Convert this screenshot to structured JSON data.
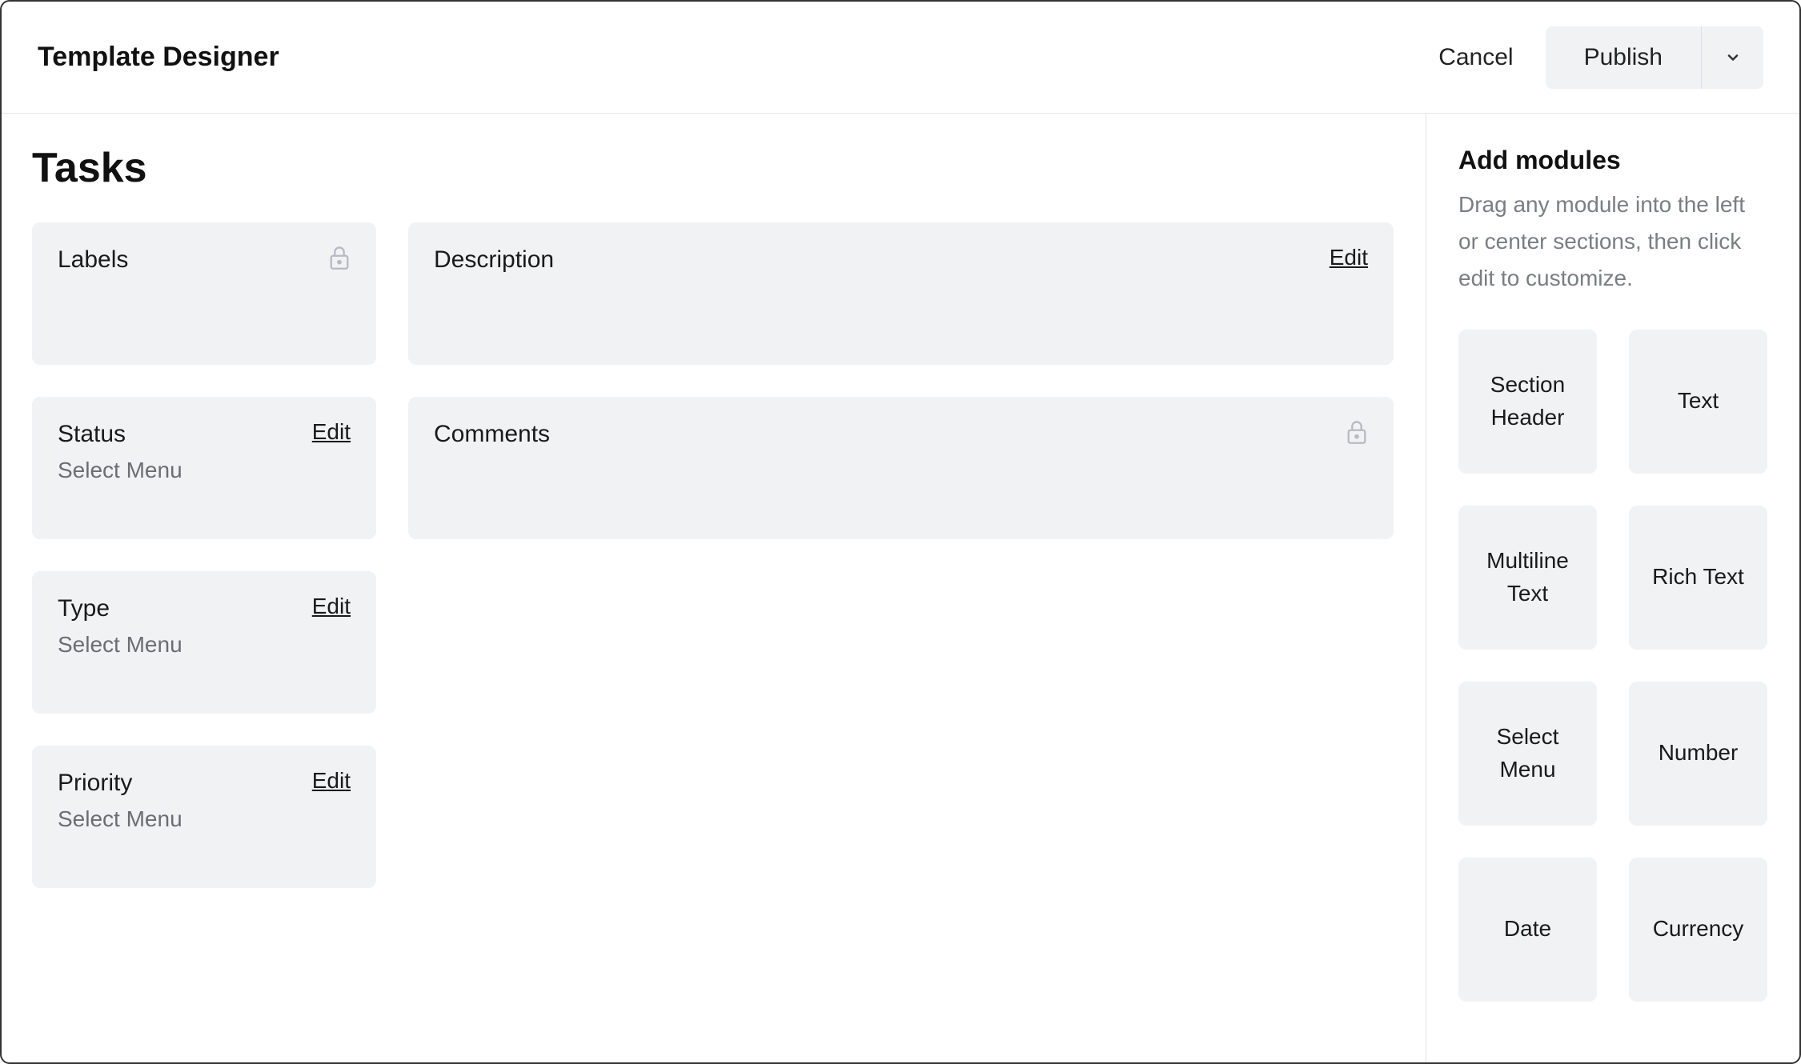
{
  "header": {
    "title": "Template Designer",
    "cancel": "Cancel",
    "publish": "Publish"
  },
  "page": {
    "heading": "Tasks"
  },
  "leftModules": [
    {
      "title": "Labels",
      "sub": "",
      "action": "lock"
    },
    {
      "title": "Status",
      "sub": "Select Menu",
      "action": "edit"
    },
    {
      "title": "Type",
      "sub": "Select Menu",
      "action": "edit"
    },
    {
      "title": "Priority",
      "sub": "Select Menu",
      "action": "edit"
    }
  ],
  "centerModules": [
    {
      "title": "Description",
      "action": "edit"
    },
    {
      "title": "Comments",
      "action": "lock"
    }
  ],
  "editLabel": "Edit",
  "sidebar": {
    "title": "Add modules",
    "description": "Drag any module into the left or center sections, then click edit to customize.",
    "modules": [
      "Section Header",
      "Text",
      "Multiline Text",
      "Rich Text",
      "Select Menu",
      "Number",
      "Date",
      "Currency"
    ]
  }
}
